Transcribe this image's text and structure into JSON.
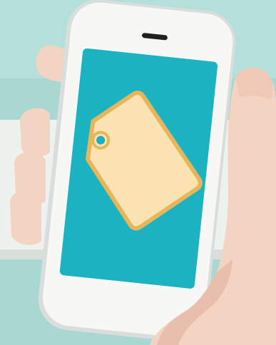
{
  "scene": {
    "subject": "hand-holding-phone",
    "icon": "price-tag-icon"
  },
  "colors": {
    "background": "#a9d8d3",
    "background_shadow": "#8fc7c1",
    "wall_band": "#eef2ef",
    "phone_body": "#f7f7f6",
    "phone_edge": "#d9dddb",
    "screen": "#1bb3c1",
    "tag_fill": "#fbe2b2",
    "tag_border": "#e7b65b",
    "tag_hole_ring": "#e7b65b",
    "tag_hole": "#19b1bf",
    "skin": "#f3d3c2",
    "skin_shadow": "#e3b7a3",
    "speaker": "#202020"
  }
}
